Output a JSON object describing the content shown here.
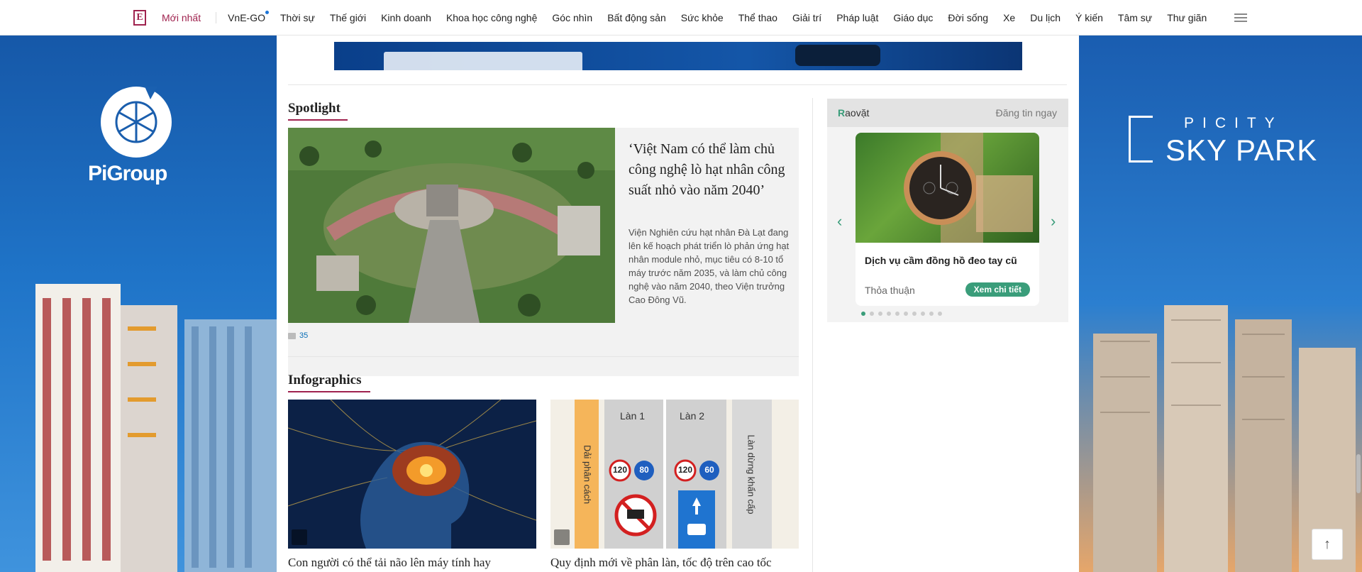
{
  "nav": {
    "logo": "E",
    "latest": "Mới nhất",
    "items": [
      "VnE-GO",
      "Thời sự",
      "Thế giới",
      "Kinh doanh",
      "Khoa học công nghệ",
      "Góc nhìn",
      "Bất động sản",
      "Sức khỏe",
      "Thể thao",
      "Giải trí",
      "Pháp luật",
      "Giáo dục",
      "Đời sống",
      "Xe",
      "Du lịch",
      "Ý kiến",
      "Tâm sự",
      "Thư giãn"
    ]
  },
  "ads": {
    "left_brand": "PiGroup",
    "right_top": "PICITY",
    "right_name": "SKY PARK"
  },
  "spotlight": {
    "section": "Spotlight",
    "title": "‘Việt Nam có thể làm chủ công nghệ lò hạt nhân công suất nhỏ vào năm 2040’",
    "desc": "Viện Nghiên cứu hạt nhân Đà Lạt đang lên kế hoạch phát triển lò phản ứng hạt nhân module nhỏ, mục tiêu có 8-10 tổ máy trước năm 2035, và làm chủ công nghệ vào năm 2040, theo Viện trưởng Cao Đông Vũ.",
    "comments": "35"
  },
  "infographics": {
    "section": "Infographics",
    "items": [
      {
        "title": "Con người có thể tải não lên máy tính hay"
      },
      {
        "title": "Quy định mới về phân làn, tốc độ trên cao tốc",
        "lane1": "Làn 1",
        "lane2": "Làn 2",
        "divider": "Dải phân cách",
        "emergency": "Làn dừng khẩn cấp",
        "limits1": [
          "120",
          "80"
        ],
        "limits2": [
          "120",
          "60"
        ]
      }
    ]
  },
  "raovat": {
    "brand": "aovặt",
    "brand_r": "R",
    "post": "Đăng tin ngay",
    "card": {
      "name": "Dịch vụ cầm đồng hồ đeo tay cũ",
      "price": "Thỏa thuận",
      "button": "Xem chi tiết"
    },
    "dots": 10,
    "active_dot": 0
  },
  "colors": {
    "brand": "#9f224e",
    "raovat": "#3a9d7a"
  }
}
